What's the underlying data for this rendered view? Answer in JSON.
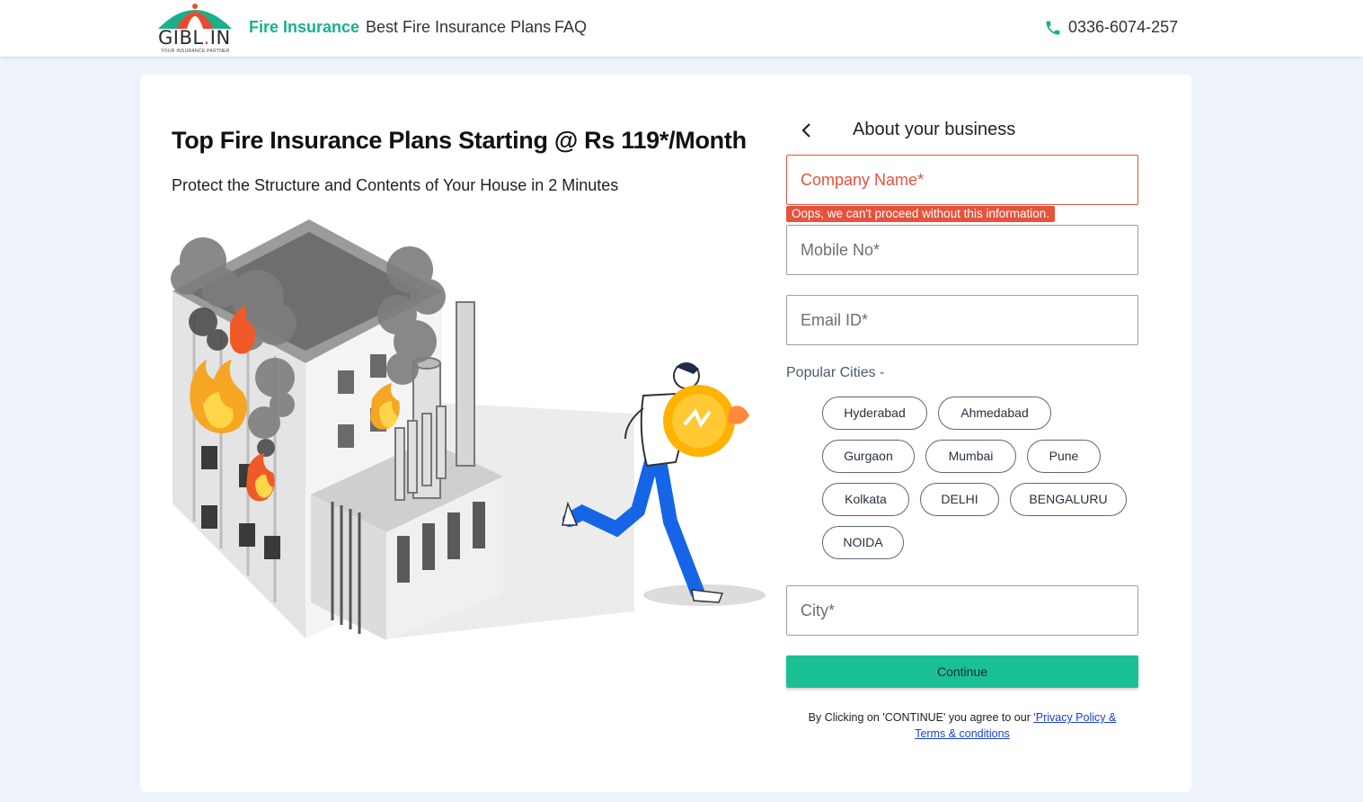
{
  "header": {
    "logo_text_main": "GIBL",
    "logo_text_dot": ".",
    "logo_text_tld": "IN",
    "logo_tagline": "YOUR INSURANCE PARTNER",
    "nav": [
      "Fire Insurance",
      "Best Fire Insurance Plans",
      "FAQ"
    ],
    "phone": "0336-6074-257"
  },
  "hero": {
    "title": "Top Fire Insurance Plans Starting @ Rs 119*/Month",
    "subtitle": "Protect the Structure and Contents of Your House in 2 Minutes"
  },
  "form": {
    "title": "About your business",
    "company_placeholder": "Company Name*",
    "company_error": "Oops, we can't proceed without this information.",
    "mobile_placeholder": "Mobile No*",
    "email_placeholder": "Email ID*",
    "cities_label": "Popular Cities -",
    "cities": [
      "Hyderabad",
      "Ahmedabad",
      "Gurgaon",
      "Mumbai",
      "Pune",
      "Kolkata",
      "DELHI",
      "BENGALURU",
      "NOIDA"
    ],
    "city_placeholder": "City*",
    "continue_label": "Continue",
    "legal_prefix": "By Clicking on 'CONTINUE' you agree to our ",
    "legal_link_1": "'Privacy Policy &",
    "legal_link_2": "Terms & conditions"
  },
  "colors": {
    "brand_green": "#1ab08a",
    "button_green": "#1bbf94",
    "error_red": "#e5533d",
    "page_bg": "#eef2fb"
  }
}
